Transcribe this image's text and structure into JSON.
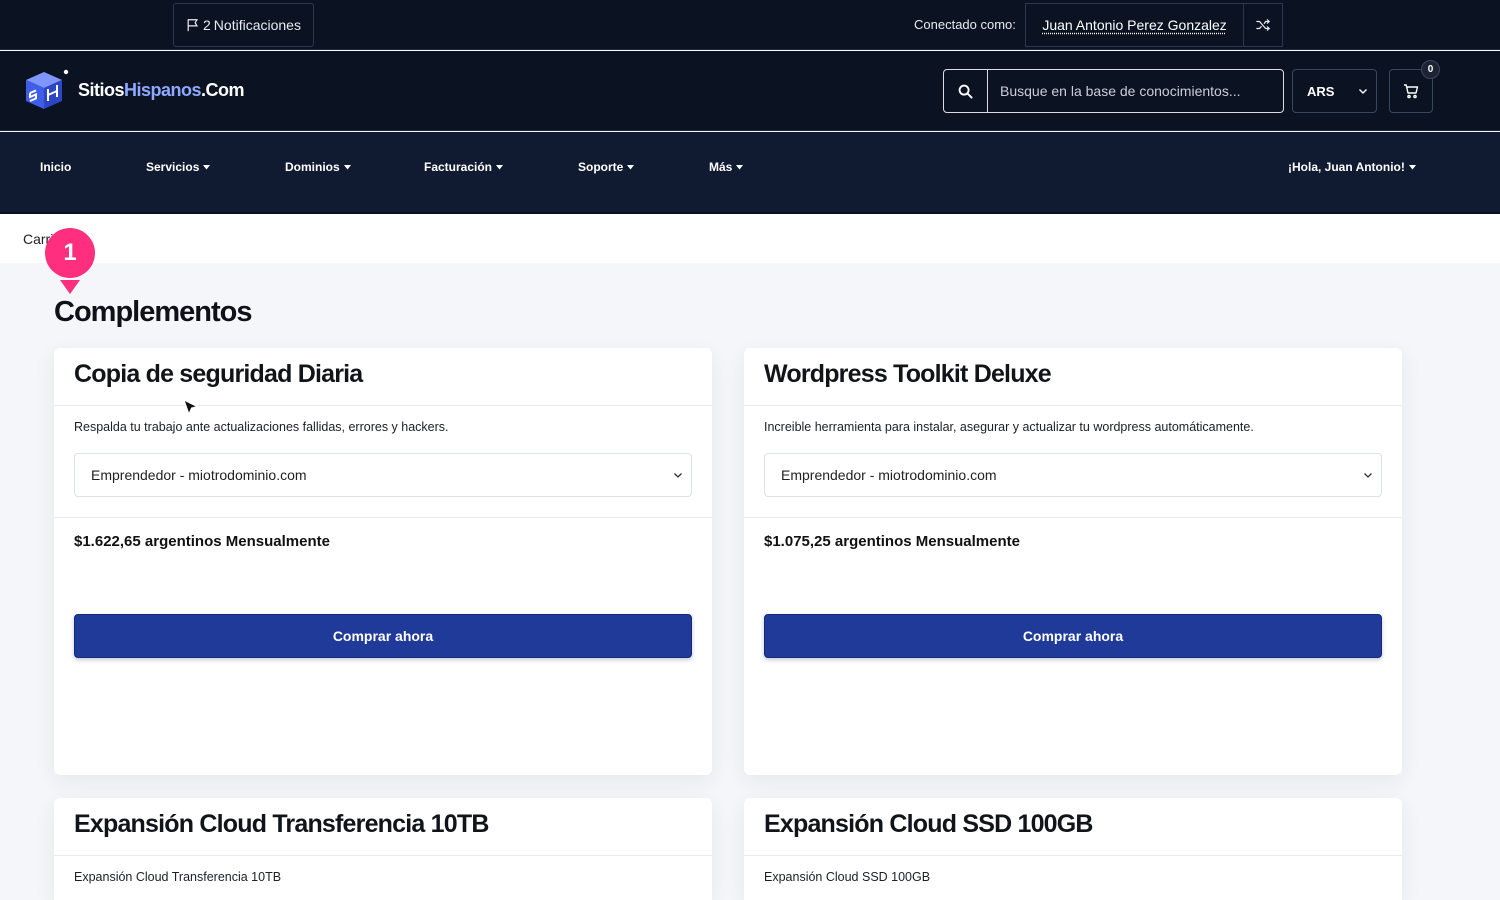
{
  "topbar": {
    "notifications_count": "2",
    "notifications_label": "Notificaciones",
    "connected_label": "Conectado como:",
    "user_name": "Juan Antonio Perez Gonzalez"
  },
  "header": {
    "logo_text_1": "Sitios",
    "logo_text_2": "Hispanos",
    "logo_text_3": ".Com",
    "search_placeholder": "Busque en la base de conocimientos...",
    "currency": "ARS",
    "cart_count": "0"
  },
  "nav": {
    "items": [
      "Inicio",
      "Servicios",
      "Dominios",
      "Facturación",
      "Soporte",
      "Más"
    ],
    "greeting": "¡Hola, Juan Antonio!"
  },
  "breadcrumb": {
    "label": "Carrito"
  },
  "step_marker": "1",
  "section_title": "Complementos",
  "cards": [
    {
      "title": "Copia de seguridad Diaria",
      "description": "Respalda tu trabajo ante actualizaciones fallidas, errores y hackers.",
      "selected_service": "Emprendedor - miotrodominio.com",
      "price": "$1.622,65 argentinos Mensualmente",
      "button": "Comprar ahora"
    },
    {
      "title": "Wordpress Toolkit Deluxe",
      "description": "Increible herramienta para instalar, asegurar y actualizar tu wordpress automáticamente.",
      "selected_service": "Emprendedor - miotrodominio.com",
      "price": "$1.075,25 argentinos Mensualmente",
      "button": "Comprar ahora"
    },
    {
      "title": "Expansión Cloud Transferencia 10TB",
      "description": "Expansión Cloud Transferencia 10TB"
    },
    {
      "title": "Expansión Cloud SSD 100GB",
      "description": "Expansión Cloud SSD 100GB"
    }
  ],
  "colors": {
    "header_bg": "#0b1323",
    "nav_bg": "#101a30",
    "primary_button": "#1f3a98",
    "step_marker": "#ff2e7e",
    "logo_accent": "#8fa8ff"
  }
}
